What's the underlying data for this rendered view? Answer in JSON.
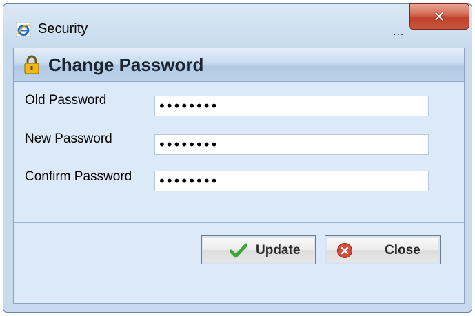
{
  "window": {
    "title": "Security",
    "ellipsis": "..."
  },
  "icons": {
    "app": "internet-explorer-icon",
    "lock": "lock-icon",
    "check": "checkmark-icon",
    "close": "close-circle-icon"
  },
  "colors": {
    "close_button": "#c8553c",
    "panel_bg": "#dce9f8",
    "window_bg": "#c8dbee"
  },
  "panel": {
    "title": "Change Password"
  },
  "form": {
    "old_label": "Old Password",
    "old_value": "••••••••",
    "new_label": "New Password",
    "new_value": "••••••••",
    "confirm_label": "Confirm Password",
    "confirm_value": "••••••••"
  },
  "buttons": {
    "update": "Update",
    "close": "Close"
  }
}
